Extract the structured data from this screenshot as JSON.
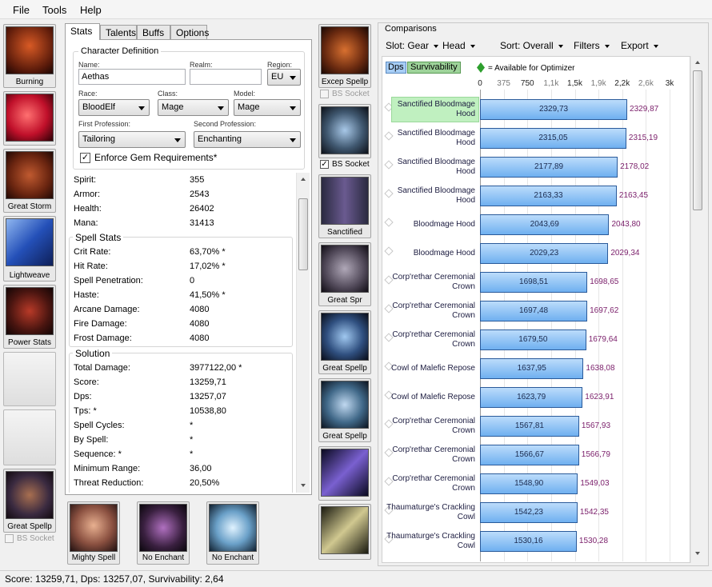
{
  "menu": [
    "File",
    "Tools",
    "Help"
  ],
  "left_slots": [
    "Burning",
    "",
    "Great Storm",
    "Lightweave",
    "Power Stats",
    "",
    "",
    "Great Spellp"
  ],
  "left_socket": "BS Socket",
  "tabs": [
    "Stats",
    "Talents",
    "Buffs",
    "Options"
  ],
  "char_def": {
    "title": "Character Definition",
    "name_label": "Name:",
    "name_value": "Aethas",
    "realm_label": "Realm:",
    "realm_value": "",
    "region_label": "Region:",
    "region_value": "EU",
    "race_label": "Race:",
    "race_value": "BloodElf",
    "class_label": "Class:",
    "class_value": "Mage",
    "model_label": "Model:",
    "model_value": "Mage",
    "prof1_label": "First Profession:",
    "prof1_value": "Tailoring",
    "prof2_label": "Second Profession:",
    "prof2_value": "Enchanting",
    "enforce_label": "Enforce Gem Requirements*",
    "enforce_checked": true
  },
  "stats": [
    {
      "label": "Spirit:",
      "value": "355"
    },
    {
      "label": "Armor:",
      "value": "2543"
    },
    {
      "label": "Health:",
      "value": "26402"
    },
    {
      "label": "Mana:",
      "value": "31413"
    }
  ],
  "spell_stats_title": "Spell Stats",
  "spell_stats": [
    {
      "label": "Crit Rate:",
      "value": "63,70% *"
    },
    {
      "label": "Hit Rate:",
      "value": "17,02% *"
    },
    {
      "label": "Spell Penetration:",
      "value": "0"
    },
    {
      "label": "Haste:",
      "value": "41,50% *"
    },
    {
      "label": "Arcane Damage:",
      "value": "4080"
    },
    {
      "label": "Fire Damage:",
      "value": "4080"
    },
    {
      "label": "Frost Damage:",
      "value": "4080"
    }
  ],
  "solution_title": "Solution",
  "solution": [
    {
      "label": "Total Damage:",
      "value": "3977122,00 *"
    },
    {
      "label": "Score:",
      "value": "13259,71"
    },
    {
      "label": "Dps:",
      "value": "13257,07"
    },
    {
      "label": "Tps: *",
      "value": "10538,80"
    },
    {
      "label": "Spell Cycles:",
      "value": "*"
    },
    {
      "label": "By Spell:",
      "value": "*"
    },
    {
      "label": "Sequence: *",
      "value": "*"
    },
    {
      "label": "Minimum Range:",
      "value": "36,00"
    },
    {
      "label": "Threat Reduction:",
      "value": "20,50%"
    }
  ],
  "bottom_slots": [
    "Mighty Spell",
    "No Enchant",
    "No Enchant"
  ],
  "mid_slots": [
    "Excep Spellp",
    "",
    "Sanctified",
    "Great Spr",
    "Great Spellp",
    "Great Spellp",
    "",
    ""
  ],
  "mid_sockets": [
    {
      "label": "BS Socket",
      "checked": false
    },
    {
      "label": "BS Socket",
      "checked": true
    }
  ],
  "comparisons": {
    "title": "Comparisons",
    "toolbar": {
      "slot": "Slot: Gear",
      "head": "Head",
      "sort": "Sort: Overall",
      "filters": "Filters",
      "export": "Export"
    },
    "legend": {
      "dps": "Dps",
      "surv": "Survivability",
      "avail": "= Available for Optimizer"
    },
    "colors": {
      "dps": "#a7cdf5",
      "surv": "#9ed39a",
      "avail": "#2e9f2e",
      "bar": "#6fb0f0",
      "value": "#7a1e6a"
    }
  },
  "chart_data": {
    "type": "bar",
    "orientation": "horizontal",
    "axis_ticks": [
      "0",
      "375",
      "750",
      "1,1k",
      "1,5k",
      "1,9k",
      "2,2k",
      "2,6k",
      "3k"
    ],
    "axis_tick_values": [
      0,
      375,
      750,
      1125,
      1500,
      1875,
      2250,
      2625,
      3000
    ],
    "xlim": [
      0,
      3000
    ],
    "items": [
      {
        "name": "Sanctified Bloodmage Hood",
        "dps": "2329,73",
        "total": "2329,87",
        "value": 2329.87,
        "highlight": true
      },
      {
        "name": "Sanctified Bloodmage Hood",
        "dps": "2315,05",
        "total": "2315,19",
        "value": 2315.19
      },
      {
        "name": "Sanctified Bloodmage Hood",
        "dps": "2177,89",
        "total": "2178,02",
        "value": 2178.02
      },
      {
        "name": "Sanctified Bloodmage Hood",
        "dps": "2163,33",
        "total": "2163,45",
        "value": 2163.45
      },
      {
        "name": "Bloodmage Hood",
        "dps": "2043,69",
        "total": "2043,80",
        "value": 2043.8
      },
      {
        "name": "Bloodmage Hood",
        "dps": "2029,23",
        "total": "2029,34",
        "value": 2029.34
      },
      {
        "name": "Corp'rethar Ceremonial Crown",
        "dps": "1698,51",
        "total": "1698,65",
        "value": 1698.65
      },
      {
        "name": "Corp'rethar Ceremonial Crown",
        "dps": "1697,48",
        "total": "1697,62",
        "value": 1697.62
      },
      {
        "name": "Corp'rethar Ceremonial Crown",
        "dps": "1679,50",
        "total": "1679,64",
        "value": 1679.64
      },
      {
        "name": "Cowl of Malefic Repose",
        "dps": "1637,95",
        "total": "1638,08",
        "value": 1638.08
      },
      {
        "name": "Cowl of Malefic Repose",
        "dps": "1623,79",
        "total": "1623,91",
        "value": 1623.91
      },
      {
        "name": "Corp'rethar Ceremonial Crown",
        "dps": "1567,81",
        "total": "1567,93",
        "value": 1567.93
      },
      {
        "name": "Corp'rethar Ceremonial Crown",
        "dps": "1566,67",
        "total": "1566,79",
        "value": 1566.79
      },
      {
        "name": "Corp'rethar Ceremonial Crown",
        "dps": "1548,90",
        "total": "1549,03",
        "value": 1549.03
      },
      {
        "name": "Thaumaturge's Crackling Cowl",
        "dps": "1542,23",
        "total": "1542,35",
        "value": 1542.35
      },
      {
        "name": "Thaumaturge's Crackling Cowl",
        "dps": "1530,16",
        "total": "1530,28",
        "value": 1530.28
      }
    ]
  },
  "status": "Score: 13259,71, Dps: 13257,07, Survivability: 2,64"
}
